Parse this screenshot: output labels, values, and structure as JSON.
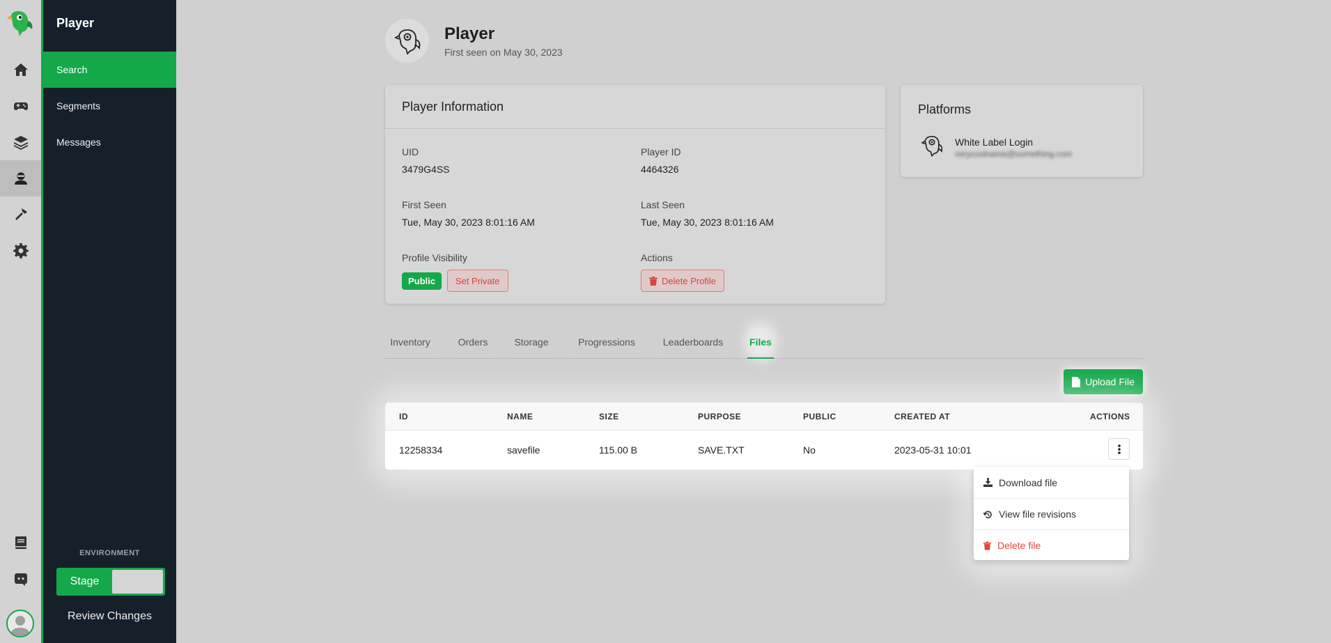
{
  "rail": {
    "icons": [
      "home-icon",
      "gamepad-icon",
      "layers-icon",
      "player-icon",
      "hammer-icon",
      "gear-icon",
      "book-icon",
      "discord-icon"
    ]
  },
  "sidebar": {
    "title": "Player",
    "items": [
      {
        "label": "Search",
        "active": true
      },
      {
        "label": "Segments",
        "active": false
      },
      {
        "label": "Messages",
        "active": false
      }
    ],
    "environment_label": "ENVIRONMENT",
    "environment_value": "Stage",
    "review_label": "Review Changes"
  },
  "header": {
    "title": "Player",
    "subtitle": "First seen on May 30, 2023"
  },
  "player_info": {
    "title": "Player Information",
    "uid_label": "UID",
    "uid_value": "3479G4SS",
    "player_id_label": "Player ID",
    "player_id_value": "4464326",
    "first_seen_label": "First Seen",
    "first_seen_value": "Tue, May 30, 2023 8:01:16 AM",
    "last_seen_label": "Last Seen",
    "last_seen_value": "Tue, May 30, 2023 8:01:16 AM",
    "visibility_label": "Profile Visibility",
    "visibility_badge": "Public",
    "set_private_label": "Set Private",
    "actions_label": "Actions",
    "delete_profile_label": "Delete Profile"
  },
  "platforms": {
    "title": "Platforms",
    "name": "White Label Login",
    "email": "verycoolname@something.com"
  },
  "tabs": [
    {
      "label": "Inventory",
      "active": false
    },
    {
      "label": "Orders",
      "active": false
    },
    {
      "label": "Storage",
      "active": false
    },
    {
      "label": "Progressions",
      "active": false
    },
    {
      "label": "Leaderboards",
      "active": false
    },
    {
      "label": "Files",
      "active": true
    }
  ],
  "upload_label": "Upload File",
  "table": {
    "columns": [
      "ID",
      "NAME",
      "SIZE",
      "PURPOSE",
      "PUBLIC",
      "CREATED AT",
      "ACTIONS"
    ],
    "rows": [
      {
        "id": "12258334",
        "name": "savefile",
        "size": "115.00 B",
        "purpose": "SAVE.TXT",
        "public": "No",
        "created_at": "2023-05-31 10:01"
      }
    ]
  },
  "menu": {
    "download": "Download file",
    "revisions": "View file revisions",
    "delete": "Delete file"
  },
  "colors": {
    "accent": "#14a84a",
    "sidebar": "#16202b",
    "danger": "#e0463d"
  }
}
